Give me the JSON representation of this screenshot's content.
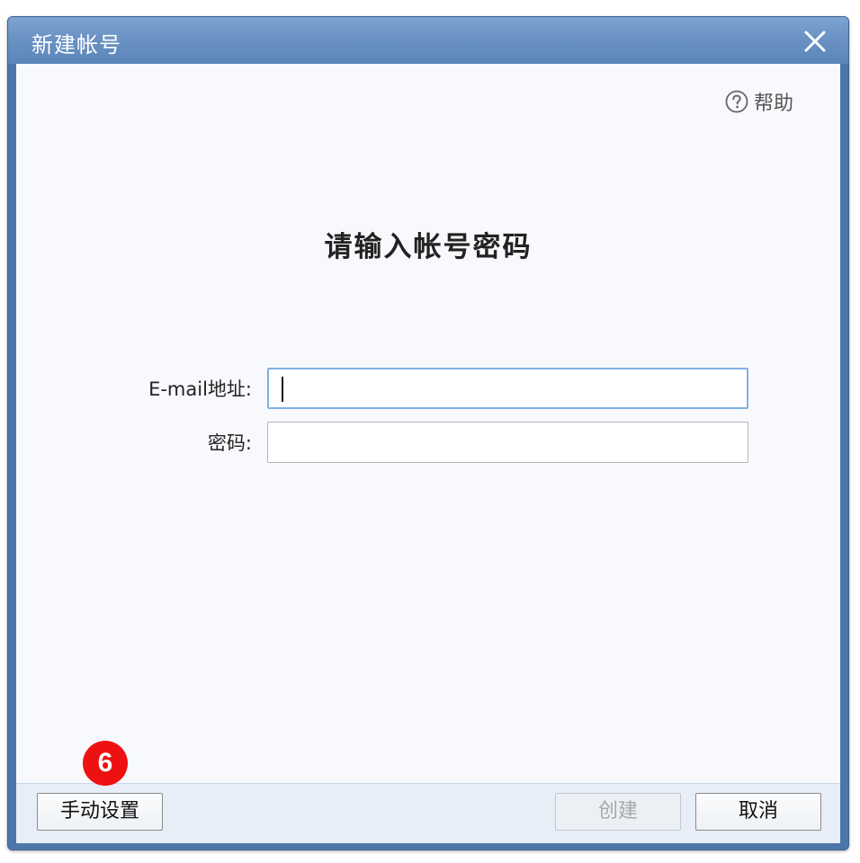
{
  "window": {
    "title": "新建帐号"
  },
  "help": {
    "icon": "help-circle-icon",
    "label": "帮助"
  },
  "heading": "请输入帐号密码",
  "form": {
    "email_label": "E-mail地址:",
    "email_value": "",
    "password_label": "密码:",
    "password_value": ""
  },
  "footer": {
    "manual_setup_label": "手动设置",
    "create_label": "创建",
    "cancel_label": "取消"
  },
  "badge": {
    "number": "6"
  },
  "colors": {
    "titlebar": "#6a92c4",
    "client_bg": "#f7f9fc",
    "badge": "#ee1111",
    "email_focus_border": "#7fb1e4"
  }
}
